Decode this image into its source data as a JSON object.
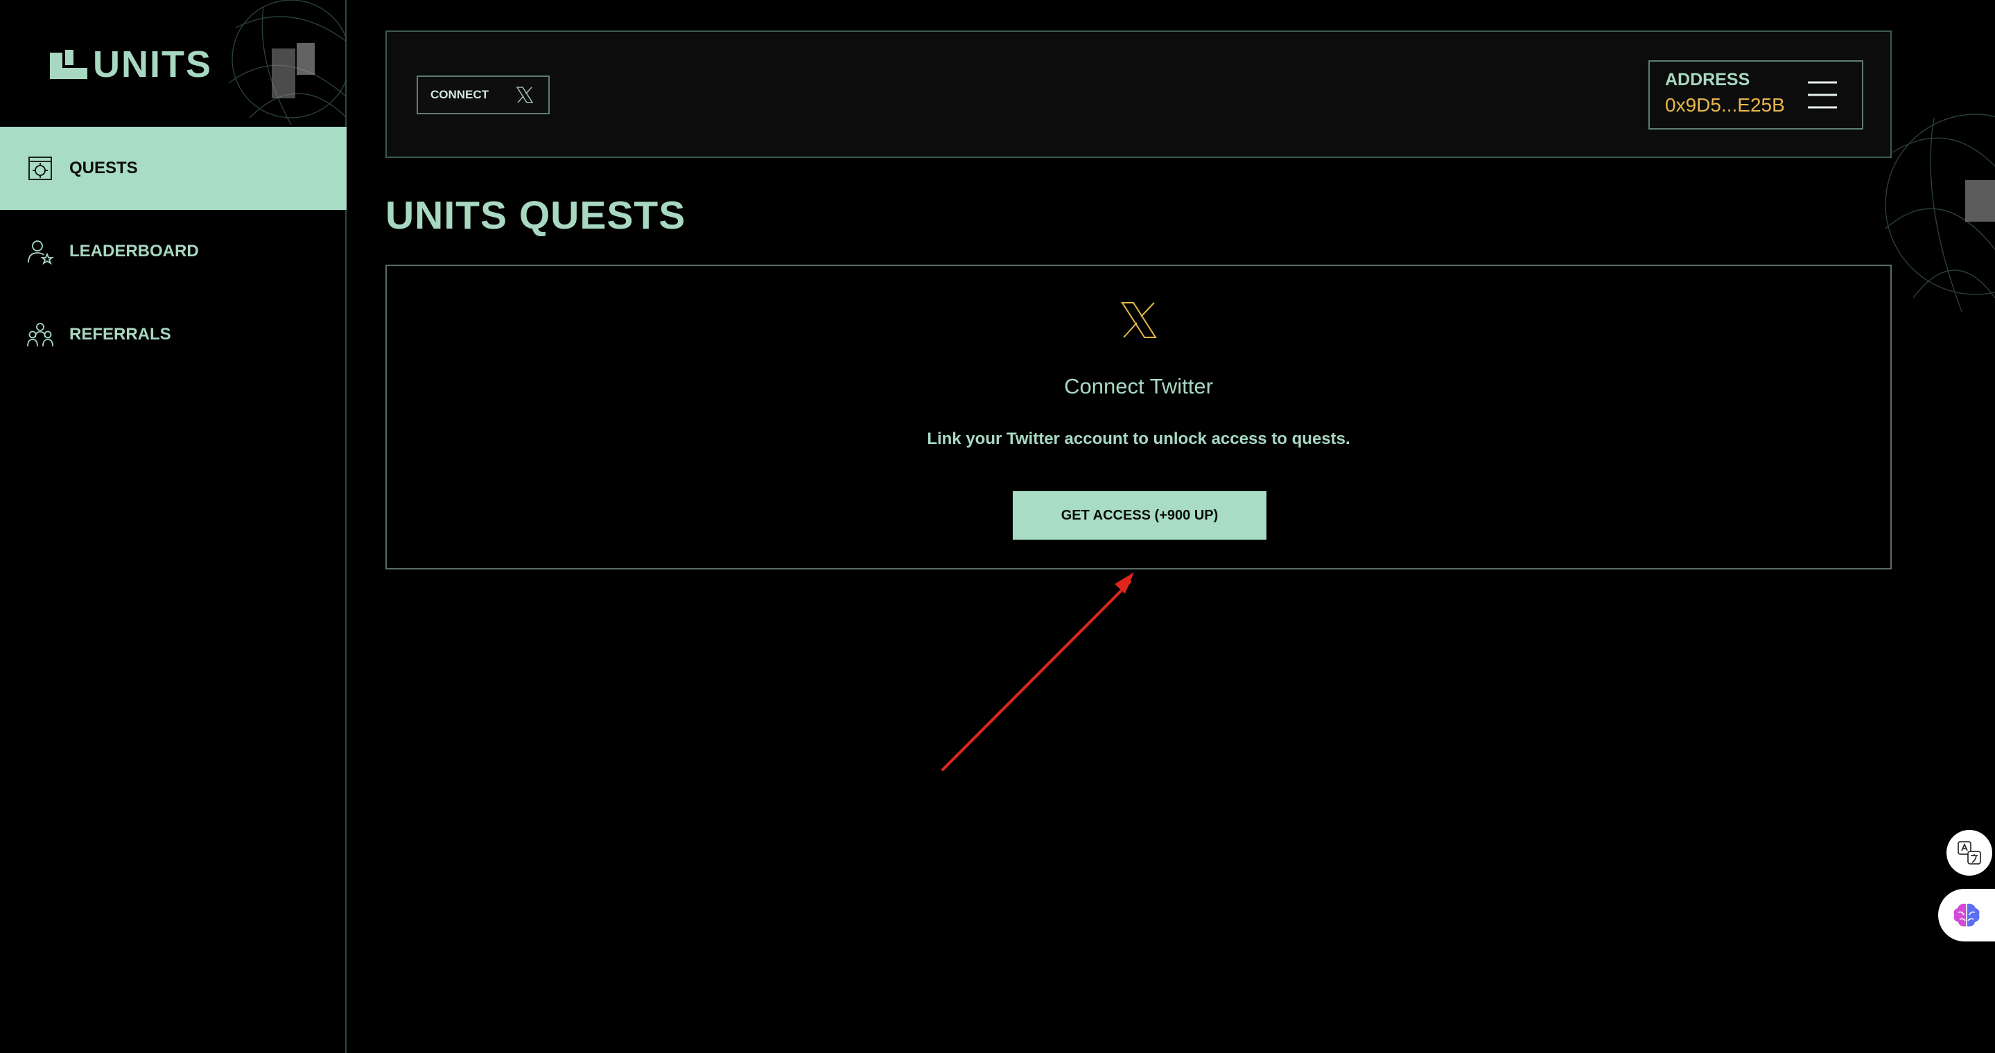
{
  "app": {
    "logo_text": "UNITS"
  },
  "sidebar": {
    "items": [
      {
        "label": "QUESTS",
        "icon": "quests-icon",
        "active": true
      },
      {
        "label": "LEADERBOARD",
        "icon": "leaderboard-icon",
        "active": false
      },
      {
        "label": "REFERRALS",
        "icon": "referrals-icon",
        "active": false
      }
    ]
  },
  "header": {
    "connect_label": "CONNECT",
    "connect_icon": "x-logo-icon",
    "address_label": "ADDRESS",
    "address_value": "0x9D5...E25B",
    "menu_icon": "hamburger-menu-icon"
  },
  "main": {
    "title": "UNITS QUESTS",
    "card": {
      "icon": "x-logo-icon",
      "title": "Connect Twitter",
      "description": "Link your Twitter account to unlock access to quests.",
      "button_label": "GET ACCESS (+900 UP)"
    }
  },
  "colors": {
    "accent": "#a8dcc4",
    "accent_text": "#a8d8c2",
    "address": "#e8b84a",
    "background": "#000000",
    "annotation_arrow": "#e0261b"
  }
}
